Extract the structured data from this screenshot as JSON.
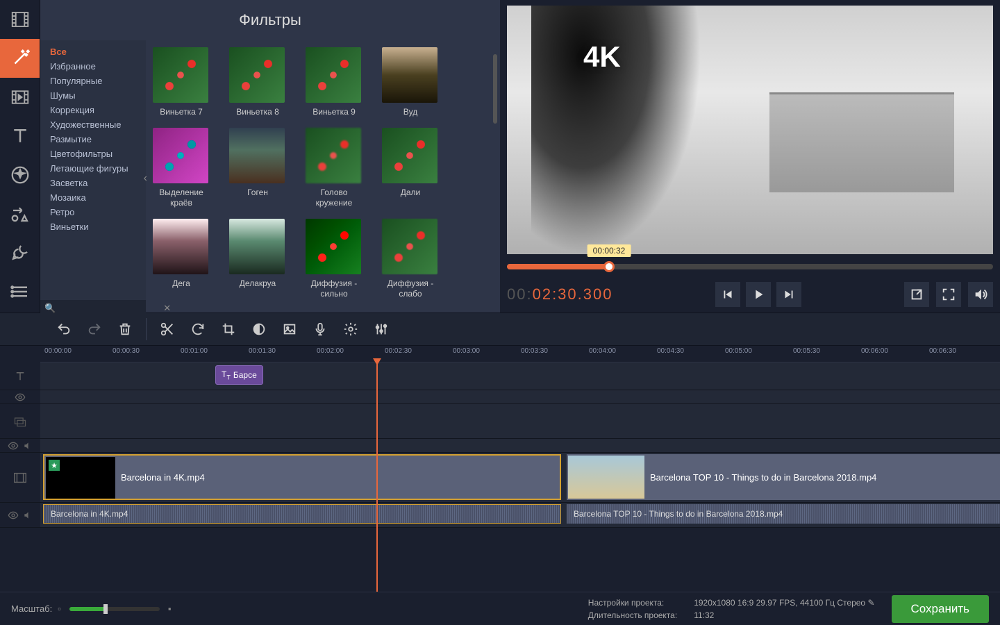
{
  "panel": {
    "title": "Фильтры"
  },
  "categories": [
    "Все",
    "Избранное",
    "Популярные",
    "Шумы",
    "Коррекция",
    "Художественные",
    "Размытие",
    "Цветофильтры",
    "Летающие фигуры",
    "Засветка",
    "Мозаика",
    "Ретро",
    "Виньетки"
  ],
  "active_category": "Все",
  "filters": [
    [
      "Виньетка 7",
      "Виньетка 8",
      "Виньетка 9",
      "Вуд"
    ],
    [
      "Выделение краёв",
      "Гоген",
      "Голово кружение",
      "Дали"
    ],
    [
      "Дега",
      "Делакруа",
      "Диффузия - сильно",
      "Диффузия - слабо"
    ]
  ],
  "preview": {
    "overlay_text": "4K",
    "scrub_tooltip": "00:00:32",
    "timecode_prefix": "00:",
    "timecode_main": "02:30.300"
  },
  "ruler_ticks": [
    "00:00:00",
    "00:00:30",
    "00:01:00",
    "00:01:30",
    "00:02:00",
    "00:02:30",
    "00:03:00",
    "00:03:30",
    "00:04:00",
    "00:04:30",
    "00:05:00",
    "00:05:30",
    "00:06:00",
    "00:06:30"
  ],
  "clips": {
    "title_clip": "Барсе",
    "video1": "Barcelona in 4K.mp4",
    "video2": "Barcelona TOP 10 - Things to do in Barcelona 2018.mp4",
    "audio1": "Barcelona in 4K.mp4",
    "audio2": "Barcelona TOP 10 - Things to do in Barcelona 2018.mp4"
  },
  "status": {
    "zoom_label": "Масштаб:",
    "settings_label": "Настройки проекта:",
    "settings_value": "1920x1080 16:9 29.97 FPS, 44100 Гц Стерео",
    "duration_label": "Длительность проекта:",
    "duration_value": "11:32",
    "save_button": "Сохранить"
  }
}
